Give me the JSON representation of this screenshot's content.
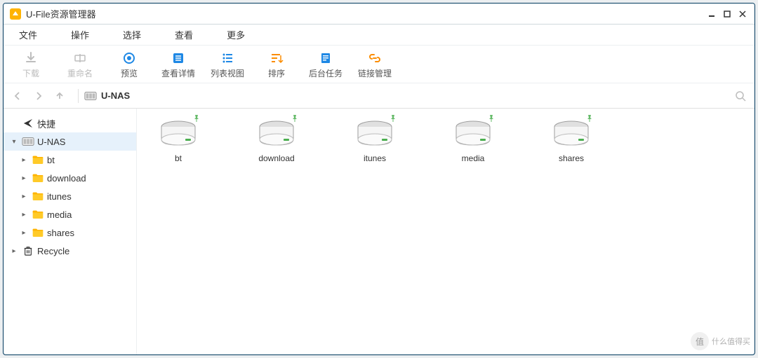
{
  "title": "U-File资源管理器",
  "menubar": [
    "文件",
    "操作",
    "选择",
    "查看",
    "更多"
  ],
  "toolbar": [
    {
      "id": "download",
      "label": "下载",
      "enabled": false,
      "color": "#bdbdbd"
    },
    {
      "id": "rename",
      "label": "重命名",
      "enabled": false,
      "color": "#bdbdbd"
    },
    {
      "id": "preview",
      "label": "预览",
      "enabled": true,
      "color": "#1e88e5"
    },
    {
      "id": "details",
      "label": "查看详情",
      "enabled": true,
      "color": "#1e88e5"
    },
    {
      "id": "listview",
      "label": "列表视图",
      "enabled": true,
      "color": "#1e88e5"
    },
    {
      "id": "sort",
      "label": "排序",
      "enabled": true,
      "color": "#fb8c00"
    },
    {
      "id": "bgtask",
      "label": "后台任务",
      "enabled": true,
      "color": "#1e88e5"
    },
    {
      "id": "linkmgr",
      "label": "链接管理",
      "enabled": true,
      "color": "#fb8c00"
    }
  ],
  "breadcrumb": {
    "root": "U-NAS"
  },
  "sidebar": {
    "quick": "快捷",
    "root": "U-NAS",
    "children": [
      "bt",
      "download",
      "itunes",
      "media",
      "shares"
    ],
    "recycle": "Recycle"
  },
  "items": [
    "bt",
    "download",
    "itunes",
    "media",
    "shares"
  ],
  "watermark": "什么值得买"
}
